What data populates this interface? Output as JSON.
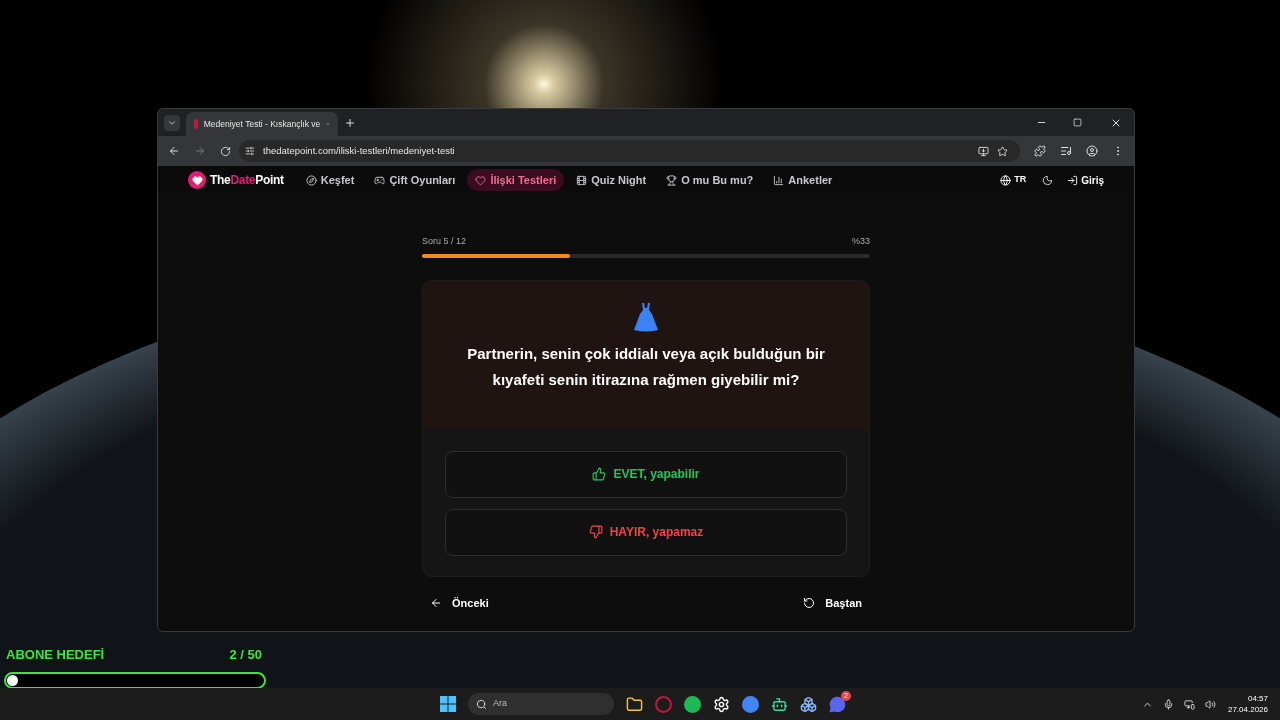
{
  "browser": {
    "tab_title": "Medeniyet Testi - Kıskançlık ve",
    "url": "thedatepoint.com/iliski-testleri/medeniyet-testi"
  },
  "site": {
    "logo_parts": [
      "The",
      "Date",
      "Point"
    ],
    "nav": [
      {
        "label": "Keşfet",
        "selected": false
      },
      {
        "label": "Çift Oyunları",
        "selected": false
      },
      {
        "label": "İlişki Testleri",
        "selected": true
      },
      {
        "label": "Quiz Night",
        "selected": false
      },
      {
        "label": "O mu Bu mu?",
        "selected": false
      },
      {
        "label": "Anketler",
        "selected": false
      }
    ],
    "language": "TR",
    "login": "Giriş"
  },
  "quiz": {
    "progress_label": "Soru 5 / 12",
    "percent": "%33",
    "level": 0.33,
    "question": "Partnerin, senin çok iddialı veya açık bulduğun bir kıyafeti senin itirazına rağmen giyebilir mi?",
    "answers": [
      {
        "kind": "yes",
        "label": "EVET, yapabilir"
      },
      {
        "kind": "no",
        "label": "HAYIR, yapamaz"
      }
    ],
    "previous": "Önceki",
    "restart": "Baştan"
  },
  "overlay": {
    "title": "ABONE HEDEFİ",
    "count": "2 / 50",
    "level": 0.04
  },
  "taskbar": {
    "search_placeholder": "Ara",
    "discord_badge": "2",
    "time": "04:57",
    "date": "27.04.2026"
  }
}
